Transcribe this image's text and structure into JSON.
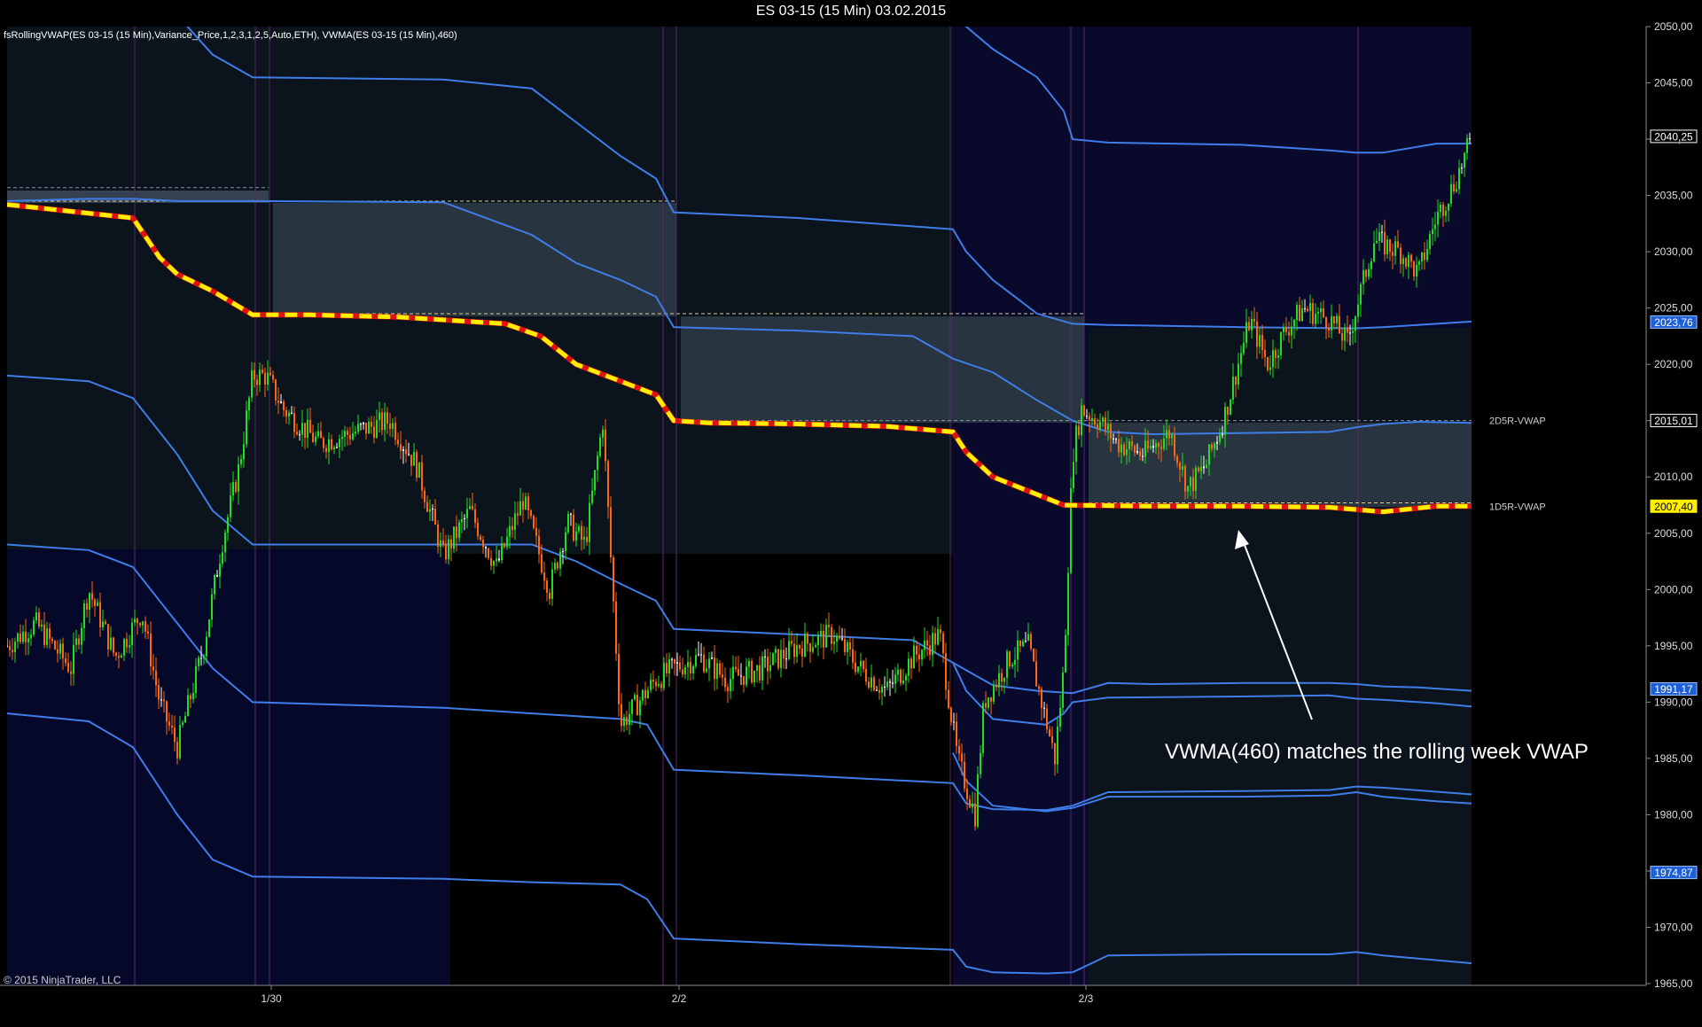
{
  "window": {
    "title": "ES 03-15 (15 Min)  03.02.2015"
  },
  "indicator_label": "fsRollingVWAP(ES 03-15 (15 Min),Variance_Price,1,2,3,1,2,5,Auto,ETH), VWMA(ES 03-15 (15 Min),460)",
  "copyright": "© 2015 NinjaTrader, LLC",
  "annotation": "VWMA(460) matches the rolling week VWAP",
  "colors": {
    "background": "#000000",
    "grid": "#3a3a3a",
    "band_blue": "#3f7de8",
    "vwap_yellow": "#ffee00",
    "vwma_red": "#e01010",
    "candle_up": "#22dd22",
    "candle_down": "#ff6611",
    "candle_doji": "#ffffff",
    "session_line": "#5a2a6a"
  },
  "chart_data": {
    "type": "line",
    "title": "ES 03-15 (15 Min)  03.02.2015",
    "symbol": "ES 03-15",
    "interval": "15 Min",
    "ylim": [
      1965,
      2050
    ],
    "y_ticks": [
      "2050,00",
      "2045,00",
      "2040,00",
      "2035,00",
      "2030,00",
      "2025,00",
      "2020,00",
      "2015,00",
      "2010,00",
      "2005,00",
      "2000,00",
      "1995,00",
      "1990,00",
      "1985,00",
      "1980,00",
      "1975,00",
      "1970,00",
      "1965,00"
    ],
    "x_ticks": [
      {
        "label": "1/30",
        "x": 306
      },
      {
        "label": "2/2",
        "x": 766
      },
      {
        "label": "2/3",
        "x": 1225
      }
    ],
    "grid": false,
    "price_tags": [
      {
        "label": "2040,25",
        "value": 2040.25,
        "style": "white"
      },
      {
        "label": "2023,76",
        "value": 2023.76,
        "style": "blue"
      },
      {
        "label": "2015,01",
        "value": 2015.01,
        "style": "white"
      },
      {
        "label": "2007,40",
        "value": 2007.4,
        "style": "yellow"
      },
      {
        "label": "1991,17",
        "value": 1991.17,
        "style": "blue"
      },
      {
        "label": "1974,87",
        "value": 1974.87,
        "style": "blue"
      }
    ],
    "level_labels": [
      {
        "label": "2D5R-VWAP",
        "value": 2015.01
      },
      {
        "label": "1D5R-VWAP",
        "value": 2007.4
      }
    ],
    "series": [
      {
        "name": "VWMA(460)",
        "role": "vwma",
        "x": [
          8,
          150,
          180,
          200,
          240,
          285,
          350,
          450,
          570,
          610,
          650,
          700,
          740,
          760,
          800,
          900,
          1000,
          1075,
          1090,
          1120,
          1200,
          1300,
          1400,
          1500,
          1560,
          1620,
          1660
        ],
        "y": [
          2034.2,
          2033.0,
          2029.5,
          2028.0,
          2026.5,
          2024.4,
          2024.4,
          2024.2,
          2023.6,
          2022.5,
          2020.0,
          2018.5,
          2017.3,
          2015.0,
          2014.8,
          2014.7,
          2014.5,
          2014.0,
          2012.2,
          2010.0,
          2007.5,
          2007.4,
          2007.4,
          2007.3,
          2006.9,
          2007.4,
          2007.4
        ]
      },
      {
        "name": "Upper band 1",
        "role": "band",
        "x": [
          8,
          100,
          150,
          200,
          240,
          285,
          500,
          600,
          650,
          700,
          740,
          760,
          900,
          1030,
          1075,
          1120,
          1170,
          1210,
          1250,
          1300,
          1400,
          1500,
          1530,
          1560,
          1600,
          1660
        ],
        "y": [
          2034.5,
          2034.7,
          2034.7,
          2034.5,
          2034.5,
          2034.5,
          2034.4,
          2031.5,
          2029.0,
          2027.5,
          2026.0,
          2023.3,
          2023.0,
          2022.5,
          2020.5,
          2019.3,
          2016.8,
          2015.0,
          2014.0,
          2013.8,
          2013.9,
          2014.0,
          2014.4,
          2014.7,
          2014.9,
          2014.8
        ]
      },
      {
        "name": "Upper band 2",
        "role": "band",
        "x": [
          8,
          100,
          150,
          200,
          240,
          285,
          500,
          600,
          650,
          700,
          740,
          760,
          900,
          1030,
          1075,
          1120,
          1170,
          1210,
          1250,
          1300,
          1400,
          1500,
          1530,
          1560,
          1600,
          1660
        ],
        "y": [
          2019.0,
          2018.5,
          2017.0,
          2012.0,
          2007.0,
          2004.0,
          2004.0,
          2004.0,
          2002.5,
          2000.5,
          1999.0,
          1996.5,
          1996.0,
          1995.5,
          1993.5,
          1991.5,
          1991.0,
          1990.8,
          1991.7,
          1991.6,
          1991.7,
          1991.7,
          1991.6,
          1991.4,
          1991.3,
          1991.0
        ]
      },
      {
        "name": "Upper band 3",
        "role": "band",
        "x": [
          8,
          150,
          200,
          240,
          285,
          500,
          600,
          650,
          700,
          740,
          760,
          900,
          1075,
          1090,
          1120,
          1170,
          1210,
          1250,
          1400,
          1530,
          1560,
          1660
        ],
        "y": [
          2055.0,
          2054.0,
          2051.0,
          2047.5,
          2045.5,
          2045.3,
          2044.5,
          2041.5,
          2038.5,
          2036.5,
          2033.5,
          2033.0,
          2032.0,
          2030.0,
          2027.5,
          2024.5,
          2023.6,
          2023.5,
          2023.3,
          2023.2,
          2023.3,
          2023.8
        ]
      },
      {
        "name": "Upper band 4",
        "role": "band",
        "x": [
          1075,
          1090,
          1120,
          1170,
          1200,
          1210,
          1250,
          1400,
          1500,
          1530,
          1560,
          1620,
          1660
        ],
        "y": [
          2051.0,
          2050.0,
          2048.0,
          2045.5,
          2042.5,
          2040.0,
          2039.7,
          2039.5,
          2039.0,
          2038.8,
          2038.8,
          2039.6,
          2039.6
        ]
      },
      {
        "name": "Lower band 1",
        "role": "band",
        "x": [
          8,
          100,
          150,
          200,
          240,
          285,
          500,
          600,
          700,
          730,
          760,
          900,
          1075,
          1090,
          1120,
          1180,
          1210,
          1250,
          1400,
          1500,
          1530,
          1560,
          1660
        ],
        "y": [
          2004.0,
          2003.5,
          2002.0,
          1997.0,
          1993.0,
          1990.0,
          1989.5,
          1989.0,
          1988.5,
          1988.0,
          1984.0,
          1983.5,
          1982.8,
          1981.0,
          1980.5,
          1980.4,
          1980.8,
          1982.0,
          1982.1,
          1982.2,
          1982.5,
          1982.4,
          1981.8
        ]
      },
      {
        "name": "Lower band 2",
        "role": "band",
        "x": [
          8,
          100,
          150,
          200,
          240,
          285,
          500,
          600,
          700,
          730,
          760,
          900,
          1075,
          1090,
          1120,
          1180,
          1210,
          1250,
          1400,
          1500,
          1530,
          1560,
          1660
        ],
        "y": [
          1989.0,
          1988.3,
          1986.0,
          1980.0,
          1976.0,
          1974.5,
          1974.3,
          1974.0,
          1973.8,
          1972.5,
          1969.0,
          1968.5,
          1968.0,
          1966.5,
          1966.0,
          1965.9,
          1966.0,
          1967.5,
          1967.6,
          1967.6,
          1967.8,
          1967.5,
          1966.8
        ]
      },
      {
        "name": "Lower band 3",
        "role": "band",
        "x": [
          1075,
          1090,
          1120,
          1180,
          1210,
          1250,
          1400,
          1500,
          1530,
          1560,
          1620,
          1660
        ],
        "y": [
          1985.5,
          1983.0,
          1980.8,
          1980.3,
          1980.6,
          1981.6,
          1981.6,
          1981.7,
          1982.0,
          1981.6,
          1981.2,
          1981.0
        ]
      },
      {
        "name": "Lower band 4",
        "role": "band",
        "x": [
          1075,
          1090,
          1120,
          1180,
          1200,
          1210,
          1250,
          1400,
          1500,
          1530,
          1560,
          1620,
          1660
        ],
        "y": [
          1993.5,
          1991.0,
          1988.5,
          1988.0,
          1989.0,
          1990.0,
          1990.4,
          1990.5,
          1990.6,
          1990.3,
          1990.2,
          1989.9,
          1989.6
        ]
      },
      {
        "name": "Price",
        "role": "price",
        "x": [
          8,
          40,
          80,
          100,
          130,
          160,
          180,
          200,
          230,
          250,
          270,
          285,
          300,
          320,
          360,
          400,
          440,
          470,
          500,
          530,
          560,
          590,
          620,
          640,
          660,
          680,
          700,
          720,
          740,
          760,
          790,
          820,
          860,
          900,
          940,
          970,
          1000,
          1030,
          1060,
          1080,
          1100,
          1110,
          1140,
          1160,
          1190,
          1200,
          1210,
          1220,
          1240,
          1260,
          1290,
          1320,
          1340,
          1360,
          1380,
          1410,
          1430,
          1450,
          1470,
          1500,
          1520,
          1550,
          1580,
          1600,
          1620,
          1640,
          1660
        ],
        "y": [
          1995,
          1997,
          1993,
          2000,
          1994,
          1998,
          1990,
          1986,
          1995,
          2004,
          2011,
          2019,
          2019,
          2016,
          2013,
          2014,
          2015,
          2011,
          2003,
          2007,
          2002,
          2008,
          2000,
          2006,
          2004,
          2015,
          1988,
          1990,
          1992,
          1993,
          1994,
          1992,
          1993,
          1995,
          1996,
          1993,
          1991,
          1994,
          1996,
          1985,
          1980,
          1990,
          1994,
          1995,
          1985,
          1993,
          2012,
          2016,
          2015,
          2013,
          2012,
          2014,
          2009,
          2011,
          2015,
          2024,
          2020,
          2023,
          2025,
          2024,
          2022,
          2031,
          2030,
          2028,
          2033,
          2036,
          2040
        ]
      }
    ]
  }
}
